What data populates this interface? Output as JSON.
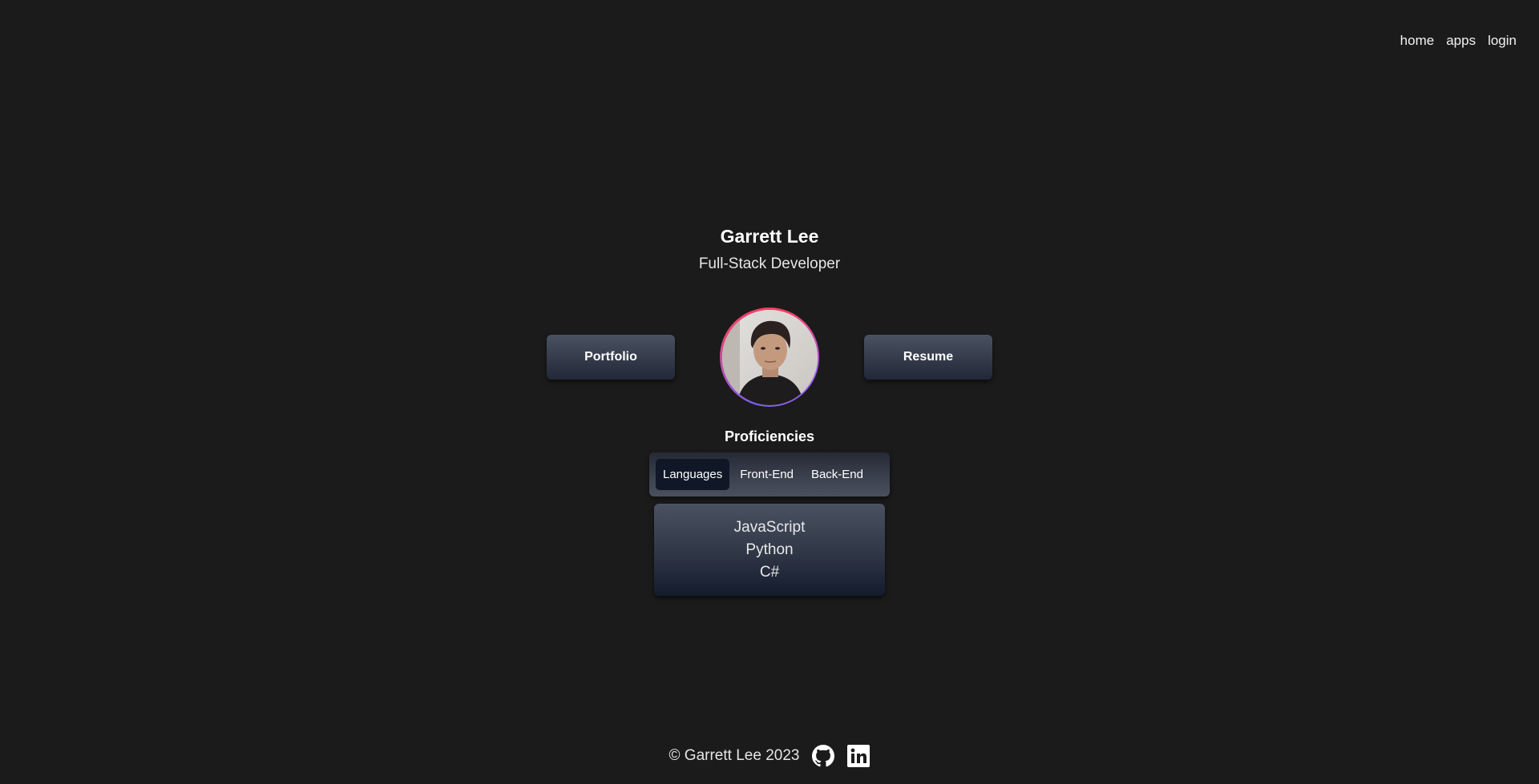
{
  "nav": {
    "items": [
      {
        "label": "home"
      },
      {
        "label": "apps"
      },
      {
        "label": "login"
      }
    ]
  },
  "header": {
    "name": "Garrett Lee",
    "role": "Full-Stack Developer"
  },
  "buttons": {
    "portfolio": "Portfolio",
    "resume": "Resume"
  },
  "avatar": {
    "alt": "Garrett Lee profile photo",
    "ring_colors": [
      "#7b5cff",
      "#e04a7a",
      "#ff3b5c"
    ]
  },
  "proficiencies": {
    "title": "Proficiencies",
    "tabs": [
      {
        "label": "Languages",
        "active": true
      },
      {
        "label": "Front-End",
        "active": false
      },
      {
        "label": "Back-End",
        "active": false
      }
    ],
    "items": [
      "JavaScript",
      "Python",
      "C#"
    ]
  },
  "footer": {
    "copyright": "© Garrett Lee 2023",
    "icons": [
      "github-icon",
      "linkedin-icon"
    ]
  },
  "colors": {
    "background": "#1b1b1b",
    "active_tab": "#101827"
  }
}
